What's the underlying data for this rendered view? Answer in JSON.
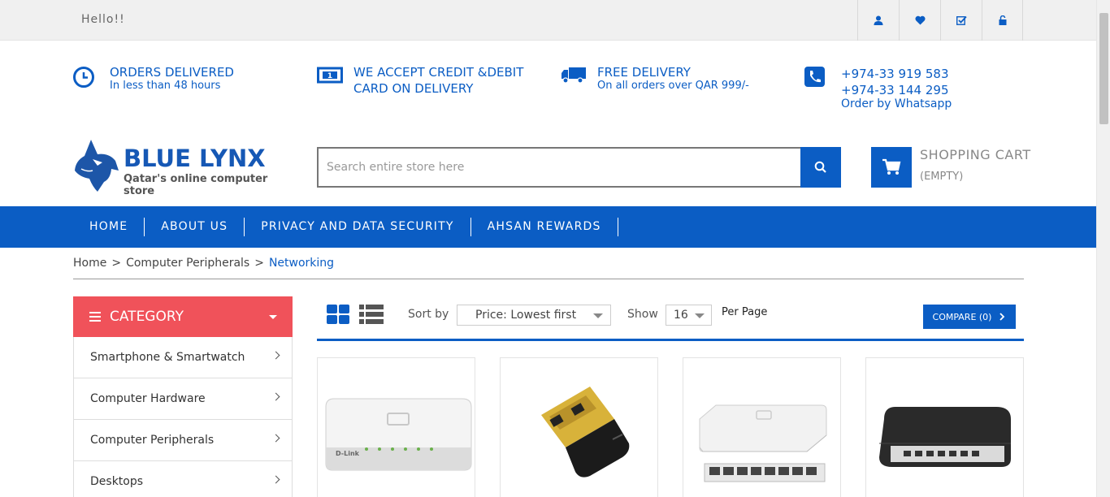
{
  "topbar": {
    "greeting": "Hello!!",
    "icons": [
      "user-icon",
      "heart-icon",
      "checklist-icon",
      "lock-icon"
    ]
  },
  "info": [
    {
      "title": "ORDERS DELIVERED",
      "subtitle": "In less than 48 hours",
      "icon": "clock-icon"
    },
    {
      "title": "WE ACCEPT CREDIT &DEBIT",
      "title2": "CARD ON DELIVERY",
      "icon": "cash-icon"
    },
    {
      "title": "FREE DELIVERY",
      "subtitle": "On all orders over QAR 999/-",
      "icon": "truck-icon"
    },
    {
      "phone1": "+974-33 919 583",
      "phone2": "+974-33 144 295",
      "subtitle": "Order by Whatsapp",
      "icon": "phone-icon"
    }
  ],
  "logo": {
    "brand": "BLUE LYNX",
    "tagline": "Qatar's online computer store"
  },
  "search": {
    "placeholder": "Search entire store here"
  },
  "cart": {
    "title": "SHOPPING CART",
    "status": "(EMPTY)"
  },
  "nav": [
    "HOME",
    "ABOUT US",
    "PRIVACY AND DATA SECURITY",
    "AHSAN REWARDS"
  ],
  "breadcrumb": {
    "home": "Home",
    "sep": ">",
    "parent": "Computer Peripherals",
    "current": "Networking"
  },
  "category": {
    "title": "CATEGORY",
    "items": [
      "Smartphone & Smartwatch",
      "Computer Hardware",
      "Computer Peripherals",
      "Desktops"
    ]
  },
  "toolbar": {
    "sort_label": "Sort by",
    "sort_value": "Price: Lowest first",
    "show_label": "Show",
    "show_value": "16",
    "per_page": "Per Page",
    "compare": "COMPARE (0)"
  },
  "products": [
    {
      "image": "dlink-white-switch"
    },
    {
      "image": "tplink-nano-usb-adapter"
    },
    {
      "image": "dlink-8port-white-switch"
    },
    {
      "image": "dlink-black-switch"
    }
  ],
  "colors": {
    "brand": "#0b5dc4",
    "category": "#f0525a"
  }
}
